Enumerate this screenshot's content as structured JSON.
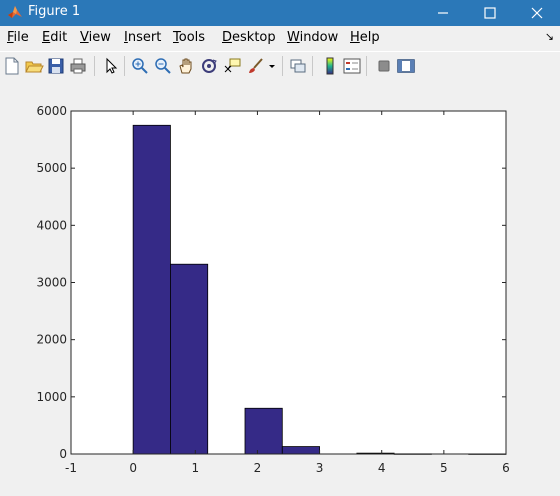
{
  "window": {
    "title": "Figure 1",
    "title_icon": "matlab-logo-icon",
    "buttons": [
      "minimize-icon",
      "maximize-icon",
      "close-icon"
    ]
  },
  "menubar": {
    "items": [
      {
        "label": "File",
        "mnemonic": "F",
        "rest": "ile"
      },
      {
        "label": "Edit",
        "mnemonic": "E",
        "rest": "dit"
      },
      {
        "label": "View",
        "mnemonic": "V",
        "rest": "iew"
      },
      {
        "label": "Insert",
        "mnemonic": "I",
        "rest": "nsert"
      },
      {
        "label": "Tools",
        "mnemonic": "T",
        "rest": "ools"
      },
      {
        "label": "Desktop",
        "mnemonic": "D",
        "rest": "esktop"
      },
      {
        "label": "Window",
        "mnemonic": "W",
        "rest": "indow"
      },
      {
        "label": "Help",
        "mnemonic": "H",
        "rest": "elp"
      }
    ],
    "dock_icon": "dock-arrow-icon",
    "dock_glyph": "↘"
  },
  "toolbar": {
    "icons": [
      "new-figure-icon",
      "open-file-icon",
      "save-icon",
      "print-icon",
      "edit-plot-icon",
      "zoom-in-icon",
      "zoom-out-icon",
      "pan-icon",
      "rotate-3d-icon",
      "data-cursor-icon",
      "brush-icon",
      "link-plot-icon",
      "insert-colorbar-icon",
      "insert-legend-icon",
      "hide-plot-tools-icon",
      "show-plot-tools-icon"
    ]
  },
  "chart_data": {
    "type": "bar",
    "bins": [
      {
        "left": 0.0,
        "right": 0.6,
        "value": 5750
      },
      {
        "left": 0.6,
        "right": 1.2,
        "value": 3320
      },
      {
        "left": 1.8,
        "right": 2.4,
        "value": 800
      },
      {
        "left": 2.4,
        "right": 3.0,
        "value": 130
      },
      {
        "left": 3.6,
        "right": 4.2,
        "value": 15
      },
      {
        "left": 4.2,
        "right": 4.8,
        "value": 3
      },
      {
        "left": 5.4,
        "right": 6.0,
        "value": 2
      }
    ],
    "xlim": [
      -1,
      6
    ],
    "ylim": [
      0,
      6000
    ],
    "xticks": [
      -1,
      0,
      1,
      2,
      3,
      4,
      5,
      6
    ],
    "yticks": [
      0,
      1000,
      2000,
      3000,
      4000,
      5000,
      6000
    ],
    "title": "",
    "xlabel": "",
    "ylabel": "",
    "bar_color": "#352a87",
    "edge_color": "#000000",
    "grid": false
  }
}
